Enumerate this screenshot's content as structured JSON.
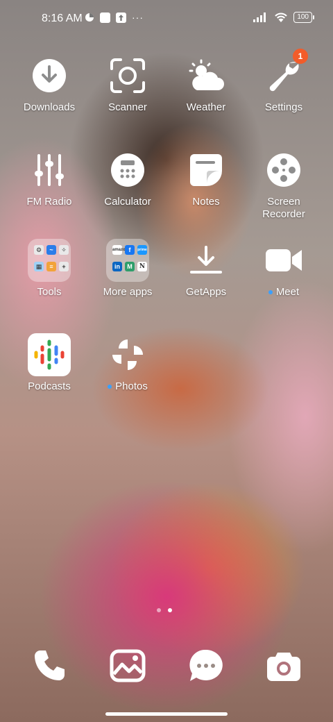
{
  "status": {
    "time": "8:16 AM",
    "battery": "100"
  },
  "apps": {
    "downloads": "Downloads",
    "scanner": "Scanner",
    "weather": "Weather",
    "settings": "Settings",
    "settings_badge": "1",
    "fm_radio": "FM Radio",
    "calculator": "Calculator",
    "notes": "Notes",
    "screen_recorder": "Screen\nRecorder",
    "tools": "Tools",
    "more_apps": "More apps",
    "getapps": "GetApps",
    "meet": "Meet",
    "podcasts": "Podcasts",
    "photos": "Photos"
  },
  "folders": {
    "more_apps_icons": [
      "amazon",
      "f",
      "prime",
      "in",
      "M",
      "N"
    ]
  },
  "colors": {
    "badge": "#f25c2a",
    "new_dot": "#3aa0ff"
  }
}
